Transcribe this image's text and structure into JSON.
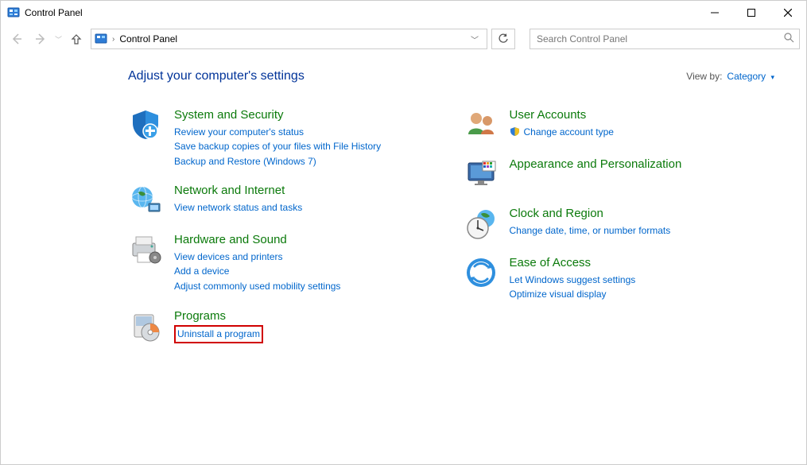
{
  "titlebar": {
    "title": "Control Panel"
  },
  "nav": {
    "breadcrumb": "Control Panel",
    "search_placeholder": "Search Control Panel"
  },
  "header": {
    "heading": "Adjust your computer's settings",
    "viewby_label": "View by:",
    "viewby_value": "Category"
  },
  "cats": {
    "system": {
      "title": "System and Security",
      "l1": "Review your computer's status",
      "l2": "Save backup copies of your files with File History",
      "l3": "Backup and Restore (Windows 7)"
    },
    "network": {
      "title": "Network and Internet",
      "l1": "View network status and tasks"
    },
    "hardware": {
      "title": "Hardware and Sound",
      "l1": "View devices and printers",
      "l2": "Add a device",
      "l3": "Adjust commonly used mobility settings"
    },
    "programs": {
      "title": "Programs",
      "l1": "Uninstall a program"
    },
    "users": {
      "title": "User Accounts",
      "l1": "Change account type"
    },
    "appearance": {
      "title": "Appearance and Personalization"
    },
    "clock": {
      "title": "Clock and Region",
      "l1": "Change date, time, or number formats"
    },
    "ease": {
      "title": "Ease of Access",
      "l1": "Let Windows suggest settings",
      "l2": "Optimize visual display"
    }
  }
}
